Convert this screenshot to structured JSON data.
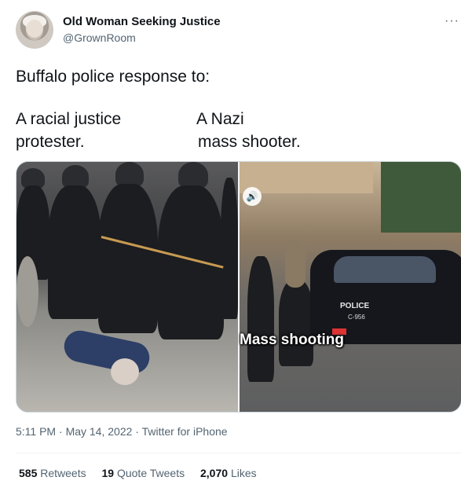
{
  "author": {
    "name": "Old Woman Seeking Justice",
    "handle": "@GrownRoom"
  },
  "more_icon": "more-dots-icon",
  "tweet": {
    "line1": "Buffalo police response to:",
    "left_label_1": "A racial justice",
    "left_label_2": "protester.",
    "right_label_1": "A Nazi",
    "right_label_2": "mass shooter."
  },
  "media": {
    "right_caption": "Mass shooting",
    "police_text": "POLICE",
    "plate_text": "C-956",
    "audio_icon": "speaker-icon"
  },
  "meta": {
    "time": "5:11 PM",
    "date": "May 14, 2022",
    "source": "Twitter for iPhone"
  },
  "stats": {
    "retweets_count": "585",
    "retweets_label": "Retweets",
    "quotes_count": "19",
    "quotes_label": "Quote Tweets",
    "likes_count": "2,070",
    "likes_label": "Likes"
  }
}
